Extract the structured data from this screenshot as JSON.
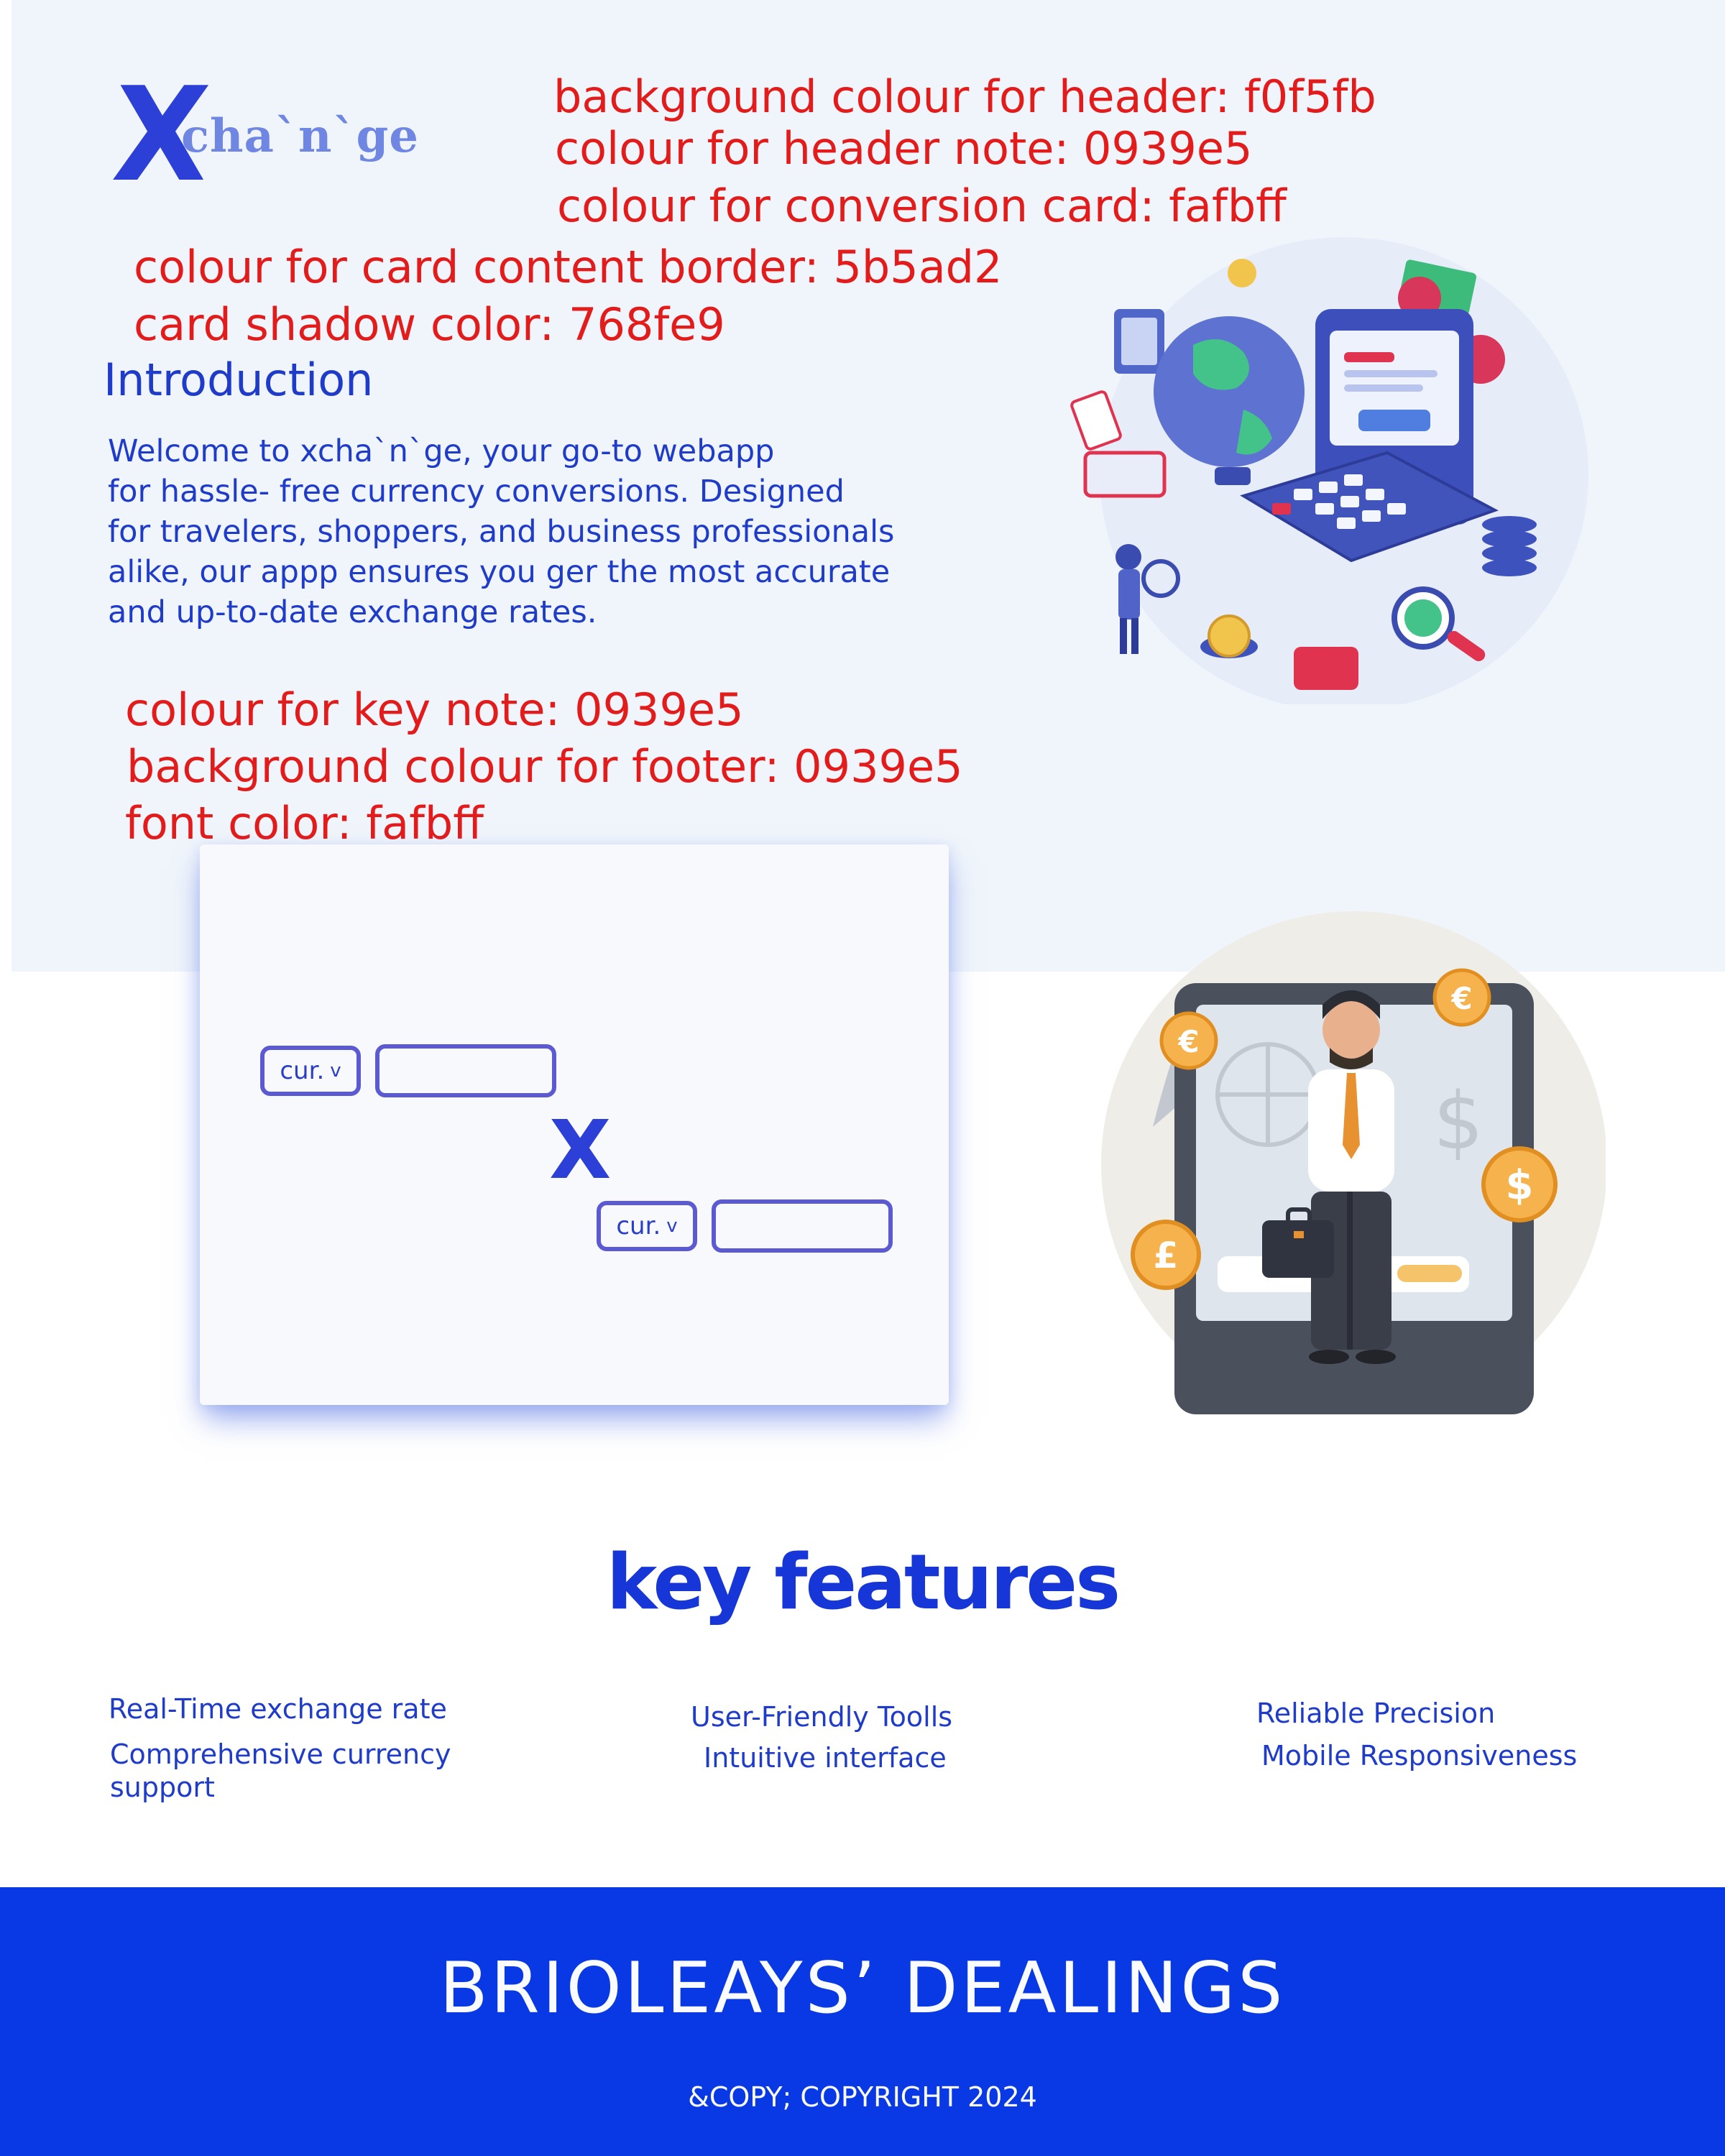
{
  "colors": {
    "header_bg": "#f0f5fb",
    "header_note": "#0939e5",
    "conversion_card": "#fafbff",
    "card_border": "#5b5ad2",
    "card_shadow": "#768fe9",
    "key_note": "#0939e5",
    "footer_bg": "#0939e5",
    "footer_font": "#fafbff",
    "annotation_red": "#e31b1b"
  },
  "logo": {
    "x": "X",
    "word": "cha`n`ge"
  },
  "notes": {
    "header_bg": "background colour for header: f0f5fb",
    "header_note": "colour for header note: 0939e5",
    "conversion_card": "colour for conversion card: fafbff",
    "card_border": "colour for card content border: 5b5ad2",
    "card_shadow": "card shadow color: 768fe9",
    "key_note": "colour for key note: 0939e5",
    "footer_bg": "background colour for footer: 0939e5",
    "font_color": "font color: fafbff"
  },
  "intro": {
    "title": "Introduction",
    "lines": [
      "Welcome to xcha`n`ge, your go-to webapp",
      "for hassle- free currency conversions. Designed",
      "for travelers, shoppers, and business professionals",
      "alike, our appp ensures you ger the most accurate",
      "and up-to-date exchange rates."
    ]
  },
  "converter": {
    "from_label": "cur.",
    "to_label": "cur.",
    "chevron": "v",
    "swap_symbol": "X",
    "from_amount": "",
    "to_amount": ""
  },
  "key_features": {
    "title": "key features",
    "col1": [
      "Real-Time exchange rate",
      "Comprehensive currency",
      "support"
    ],
    "col2": [
      "User-Friendly Toolls",
      "Intuitive interface"
    ],
    "col3": [
      "Reliable Precision",
      "Mobile Responsiveness"
    ]
  },
  "footer": {
    "title": "BRIOLEAYS’ DEALINGS",
    "copyright": "&COPY; COPYRIGHT 2024"
  }
}
